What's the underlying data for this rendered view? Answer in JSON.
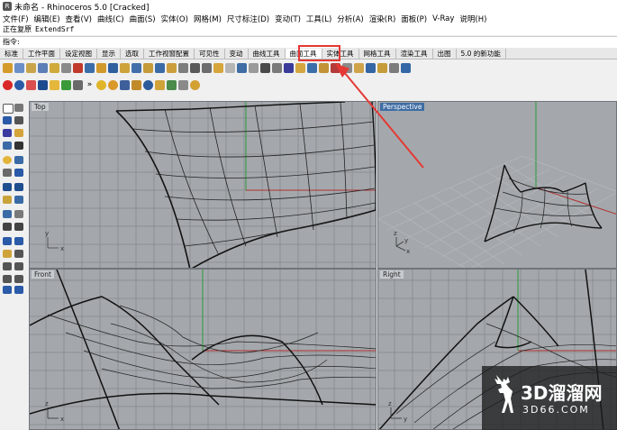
{
  "window": {
    "title": "未命名 - Rhinoceros 5.0 [Cracked]"
  },
  "menu": [
    "文件(F)",
    "编辑(E)",
    "查看(V)",
    "曲线(C)",
    "曲面(S)",
    "实体(O)",
    "网格(M)",
    "尺寸标注(D)",
    "变动(T)",
    "工具(L)",
    "分析(A)",
    "渲染(R)",
    "面板(P)",
    "V-Ray",
    "说明(H)"
  ],
  "command_history": {
    "label": "正在复原",
    "value": "ExtendSrf"
  },
  "command_prompt": "指令:",
  "tabs": [
    "标准",
    "工作平面",
    "设定视图",
    "显示",
    "选取",
    "工作视窗配置",
    "可见性",
    "变动",
    "曲线工具",
    "曲面工具",
    "实体工具",
    "网格工具",
    "渲染工具",
    "出图",
    "5.0 的新功能"
  ],
  "active_tab": "曲面工具",
  "viewports": {
    "top": "Top",
    "perspective": "Perspective",
    "front": "Front",
    "right": "Right"
  },
  "axes": {
    "x": "x",
    "y": "y",
    "z": "z"
  },
  "watermark": {
    "main": "3D溜溜网",
    "sub": "3D66.COM"
  },
  "colors": {
    "highlight": "#e53935",
    "viewport_bg": "#a4a8ac",
    "active_label": "#3f6da4"
  }
}
